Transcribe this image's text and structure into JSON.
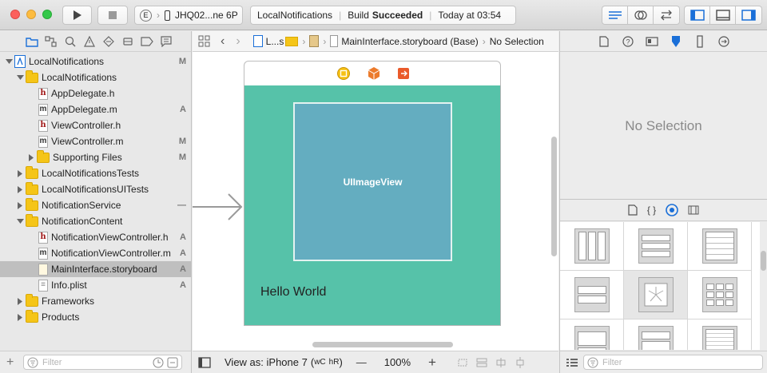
{
  "toolbar": {
    "scheme_target": "JHQ02...ne 6P",
    "scheme_e": "E",
    "activity_app": "LocalNotifications",
    "activity_build": "Build",
    "activity_status": "Succeeded",
    "activity_time": "Today at 03:54"
  },
  "navigator": {
    "items": [
      {
        "label": "LocalNotifications",
        "status": "M"
      },
      {
        "label": "LocalNotifications",
        "status": ""
      },
      {
        "label": "AppDelegate.h",
        "status": ""
      },
      {
        "label": "AppDelegate.m",
        "status": "A"
      },
      {
        "label": "ViewController.h",
        "status": ""
      },
      {
        "label": "ViewController.m",
        "status": "M"
      },
      {
        "label": "Supporting Files",
        "status": "M"
      },
      {
        "label": "LocalNotificationsTests",
        "status": ""
      },
      {
        "label": "LocalNotificationsUITests",
        "status": ""
      },
      {
        "label": "NotificationService",
        "status": "—"
      },
      {
        "label": "NotificationContent",
        "status": ""
      },
      {
        "label": "NotificationViewController.h",
        "status": "A"
      },
      {
        "label": "NotificationViewController.m",
        "status": "A"
      },
      {
        "label": "MainInterface.storyboard",
        "status": "A"
      },
      {
        "label": "Info.plist",
        "status": "A"
      },
      {
        "label": "Frameworks",
        "status": ""
      },
      {
        "label": "Products",
        "status": ""
      }
    ],
    "filter_placeholder": "Filter"
  },
  "editor": {
    "breadcrumb_project": "L...s",
    "breadcrumb_file": "MainInterface.storyboard (Base)",
    "breadcrumb_selection": "No Selection",
    "imageview_label": "UIImageView",
    "hello_label": "Hello World",
    "view_as": "View as: iPhone 7",
    "size_class_w": "wC",
    "size_class_h": "hR",
    "zoom": "100%",
    "zoom_out": "—",
    "zoom_in": "+"
  },
  "inspector": {
    "no_selection": "No Selection",
    "filter_placeholder": "Filter"
  }
}
